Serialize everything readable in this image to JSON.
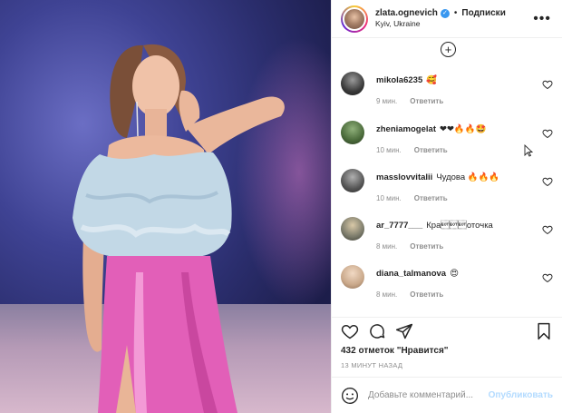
{
  "header": {
    "username": "zlata.ognevich",
    "follow_label": "Подписки",
    "dot": "•",
    "location": "Kyiv, Ukraine"
  },
  "comments": [
    {
      "user": "mikola6235",
      "text": "🥰",
      "time": "9 мин.",
      "reply": "Ответить",
      "avatar_color": "#3a3a3a"
    },
    {
      "user": "zheniamogelat",
      "text": "❤❤🔥🔥🤩",
      "time": "10 мин.",
      "reply": "Ответить",
      "avatar_color": "#4a6a3a"
    },
    {
      "user": "masslovvitalii",
      "text": "Чудова 🔥🔥🔥",
      "time": "10 мин.",
      "reply": "Ответить",
      "avatar_color": "#555555"
    },
    {
      "user": "ar_7777___",
      "text": "Кра\u0004\u0004\u0004оточка",
      "time": "8 мин.",
      "reply": "Ответить",
      "avatar_color": "#7a7a6a"
    },
    {
      "user": "diana_talmanova",
      "text": "😍",
      "time": "8 мин.",
      "reply": "Ответить",
      "avatar_color": "#c9a88a"
    }
  ],
  "likes": "432 отметок \"Нравится\"",
  "posted_time": "13 МИНУТ НАЗАД",
  "add_comment": {
    "placeholder": "Добавьте комментарий...",
    "post_label": "Опубликовать"
  },
  "colors": {
    "accent": "#3897f0",
    "post_disabled": "#b3dbff",
    "muted": "#8e8e8e"
  },
  "icons": [
    "verified-icon",
    "more-options-icon",
    "load-more-icon",
    "heart-icon",
    "comment-icon",
    "share-icon",
    "bookmark-icon",
    "emoji-icon",
    "cursor-icon"
  ]
}
